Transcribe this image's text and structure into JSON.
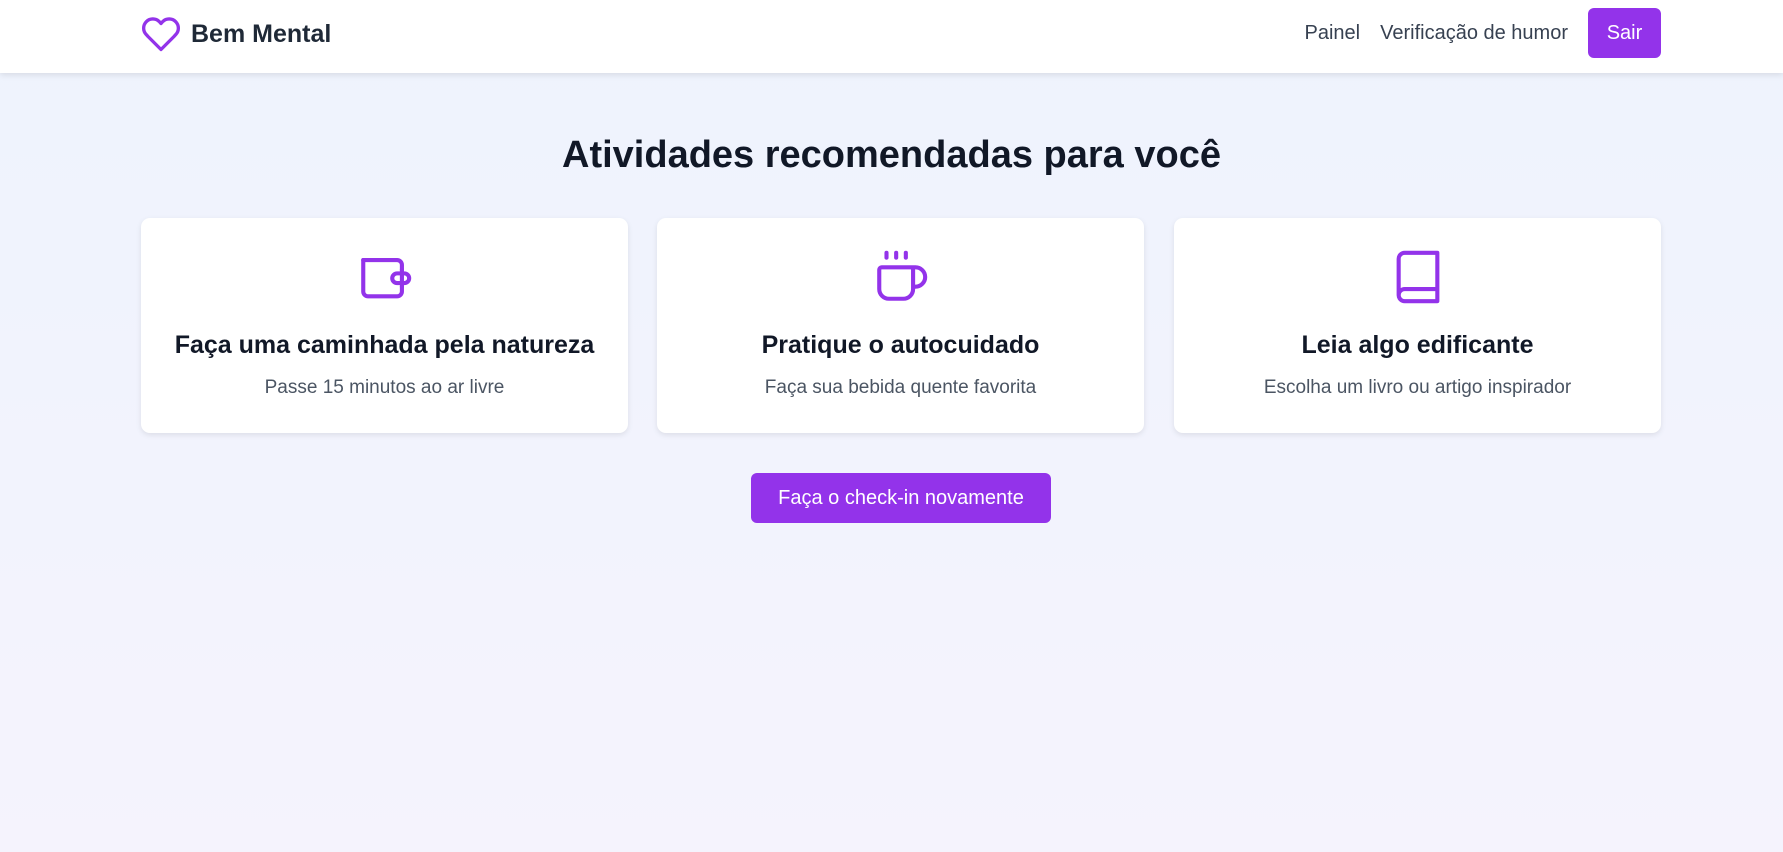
{
  "app": {
    "name": "Bem Mental",
    "accent_color": "#9333ea",
    "logo_icon": "heart-icon"
  },
  "nav": {
    "links": [
      {
        "label": "Painel"
      },
      {
        "label": "Verificação de humor"
      }
    ],
    "logout_label": "Sair"
  },
  "page": {
    "title": "Atividades recomendadas para você"
  },
  "activities": [
    {
      "icon": "wallet-icon",
      "title": "Faça uma caminhada pela natureza",
      "description": "Passe 15 minutos ao ar livre"
    },
    {
      "icon": "mug-icon",
      "title": "Pratique o autocuidado",
      "description": "Faça sua bebida quente favorita"
    },
    {
      "icon": "book-icon",
      "title": "Leia algo edificante",
      "description": "Escolha um livro ou artigo inspirador"
    }
  ],
  "cta": {
    "label": "Faça o check-in novamente"
  }
}
